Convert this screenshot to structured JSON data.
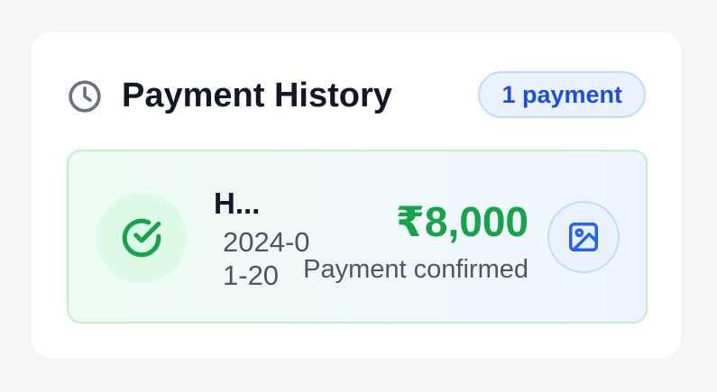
{
  "header": {
    "title": "Payment History",
    "count_label": "1 payment",
    "icon": "clock-icon"
  },
  "payments": [
    {
      "payee": "H...",
      "date": "2024-01-20",
      "amount": "₹8,000",
      "status": "Payment confirmed",
      "status_icon": "check-circle-icon",
      "action_icon": "image-icon"
    }
  ],
  "colors": {
    "success": "#16a34a",
    "accent": "#1d4ed8",
    "muted": "#6b7280"
  }
}
